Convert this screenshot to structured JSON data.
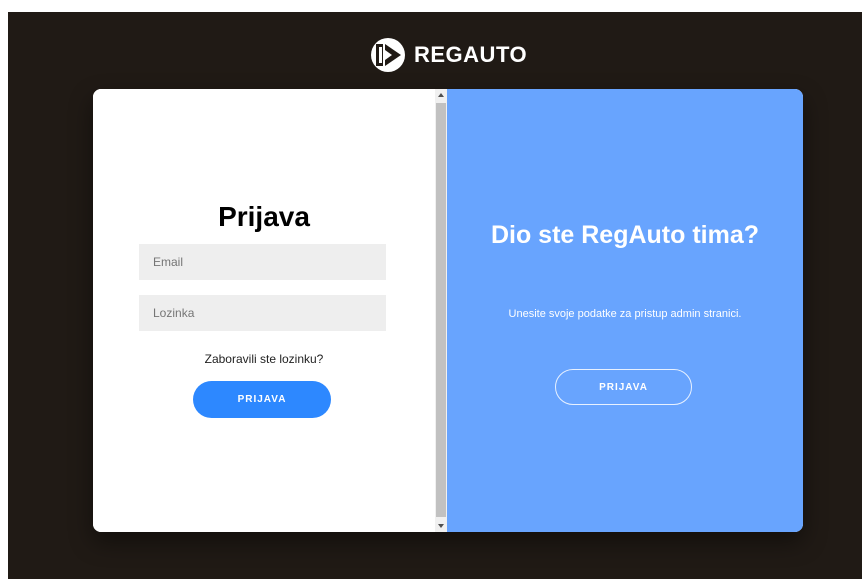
{
  "brand": {
    "name": "REGAUTO",
    "logo_icon": "regauto-logo-icon"
  },
  "login_form": {
    "title": "Prijava",
    "email_placeholder": "Email",
    "password_placeholder": "Lozinka",
    "forgot_link": "Zaboravili ste lozinku?",
    "submit_label": "PRIJAVA"
  },
  "overlay": {
    "title": "Dio ste RegAuto tima?",
    "text": "Unesite svoje podatke za pristup admin stranici.",
    "button_label": "PRIJAVA"
  },
  "colors": {
    "page_background": "#201a15",
    "overlay_background": "#68a4fe",
    "primary_button": "#2d88ff",
    "input_background": "#eeeeee"
  }
}
